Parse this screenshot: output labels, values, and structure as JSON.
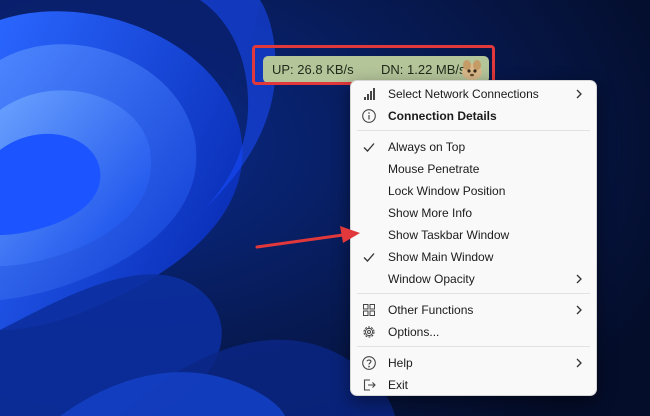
{
  "widget": {
    "upload": "UP: 26.8 KB/s",
    "download": "DN: 1.22 MB/s"
  },
  "menu": {
    "items": [
      {
        "label": "Select Network Connections",
        "icon": "signal-bars-icon",
        "submenu": true
      },
      {
        "label": "Connection Details",
        "icon": "info-icon",
        "bold": true
      },
      {
        "label": "Always on Top",
        "checked": true
      },
      {
        "label": "Mouse Penetrate"
      },
      {
        "label": "Lock Window Position"
      },
      {
        "label": "Show More Info"
      },
      {
        "label": "Show Taskbar Window"
      },
      {
        "label": "Show Main Window",
        "checked": true
      },
      {
        "label": "Window Opacity",
        "submenu": true
      },
      {
        "label": "Other Functions",
        "icon": "grid-icon",
        "submenu": true
      },
      {
        "label": "Options...",
        "icon": "gear-icon"
      },
      {
        "label": "Help",
        "icon": "help-icon",
        "submenu": true
      },
      {
        "label": "Exit",
        "icon": "exit-icon"
      }
    ]
  },
  "colors": {
    "desktop_background": "#061336",
    "bloom_blue": "#1a4cff",
    "highlight_red": "#e0383b",
    "widget_background": "#b5c59a",
    "menu_background": "#f9f9f9"
  }
}
